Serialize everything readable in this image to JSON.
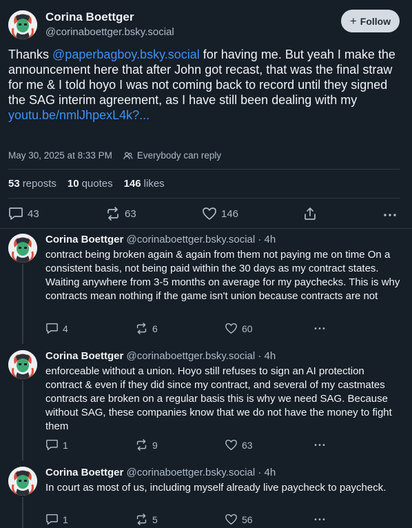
{
  "colors": {
    "background": "#161e27",
    "text": "#f1f3f5",
    "muted": "#aebbc9",
    "link": "#3d91f5",
    "follow_bg": "#d4dbe2",
    "divider": "#2e3a47"
  },
  "post": {
    "author_name": "Corina Boettger",
    "author_handle": "@corinaboettger.bsky.social",
    "follow_label": "Follow",
    "text_before_mention": "Thanks ",
    "mention": "@paperbagboy.bsky.social",
    "text_after_mention": " for having me. But yeah I make the announcement here that after John got recast, that was the final straw for me & I told hoyo I was not coming back to record until they signed the SAG interim agreement, as I have still been dealing with my ",
    "link_text": "youtu.be/nmlJhpexL4k?...",
    "timestamp": "May 30, 2025 at 8:33 PM",
    "reply_setting": "Everybody can reply",
    "stats": {
      "reposts_count": "53",
      "reposts_label": "reposts",
      "quotes_count": "10",
      "quotes_label": "quotes",
      "likes_count": "146",
      "likes_label": "likes"
    },
    "actions": {
      "replies": "43",
      "reposts": "63",
      "likes": "146"
    }
  },
  "replies": [
    {
      "author_name": "Corina Boettger",
      "author_handle": "@corinaboettger.bsky.social · 4h",
      "text": "contract being broken again & again from them not paying me on time On a consistent basis, not being paid within the 30 days as my contract states. Waiting anywhere from 3-5 months on average for my paychecks. This is why contracts mean nothing if the game isn't union because contracts are not",
      "replies": "4",
      "reposts": "6",
      "likes": "60"
    },
    {
      "author_name": "Corina Boettger",
      "author_handle": "@corinaboettger.bsky.social · 4h",
      "text": "enforceable without a union. Hoyo still refuses to sign an AI protection contract & even if they did since my contract, and several of my castmates contracts are broken on a regular basis this is why we need SAG. Because without SAG, these companies know that we do not have the money to fight them",
      "replies": "1",
      "reposts": "9",
      "likes": "63"
    },
    {
      "author_name": "Corina Boettger",
      "author_handle": "@corinaboettger.bsky.social · 4h",
      "text": "In court as most of us, including myself already live paycheck to paycheck.",
      "replies": "1",
      "reposts": "5",
      "likes": "56"
    }
  ]
}
